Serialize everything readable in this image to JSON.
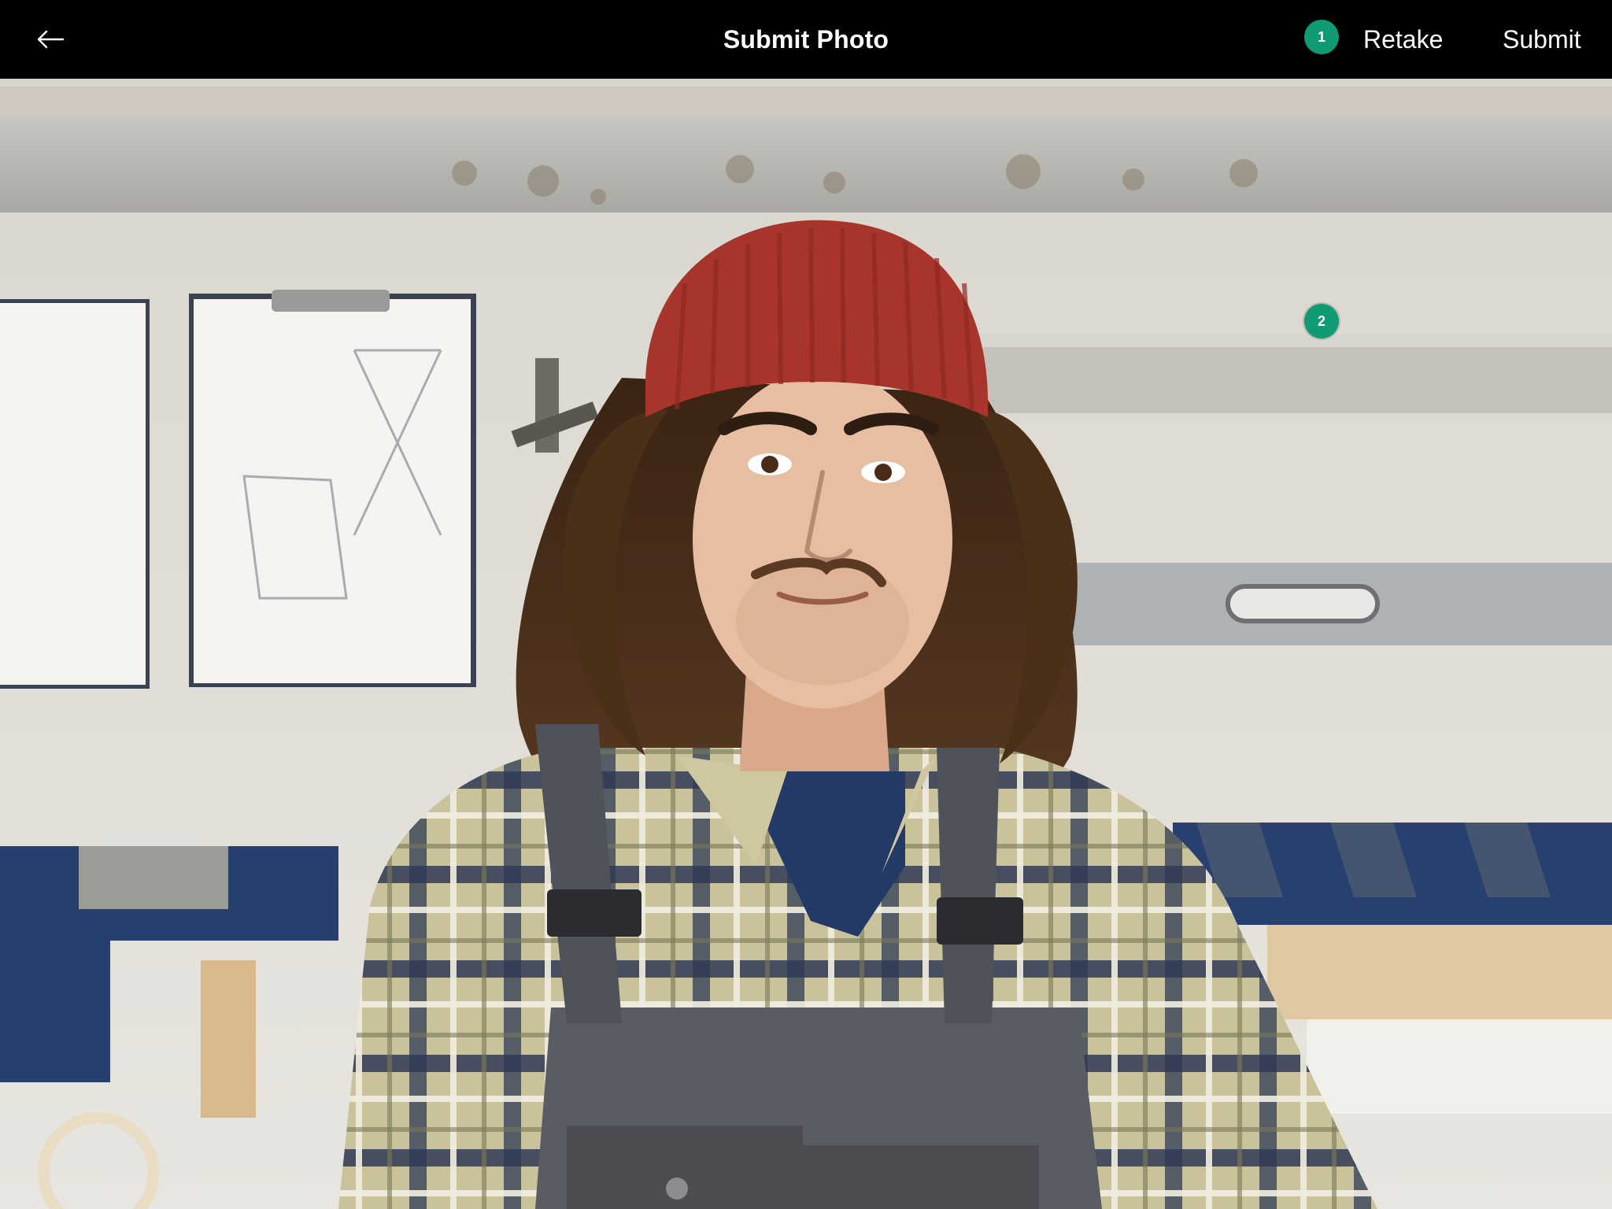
{
  "header": {
    "title": "Submit Photo",
    "back_icon": "arrow-left-icon",
    "retake_label": "Retake",
    "submit_label": "Submit"
  },
  "badges": [
    {
      "label": "1"
    },
    {
      "label": "2"
    }
  ],
  "colors": {
    "header_bg": "#000000",
    "badge_green": "#0f9b73",
    "beanie_red": "#a8352b"
  },
  "photo": {
    "subject": "portrait-photo"
  }
}
